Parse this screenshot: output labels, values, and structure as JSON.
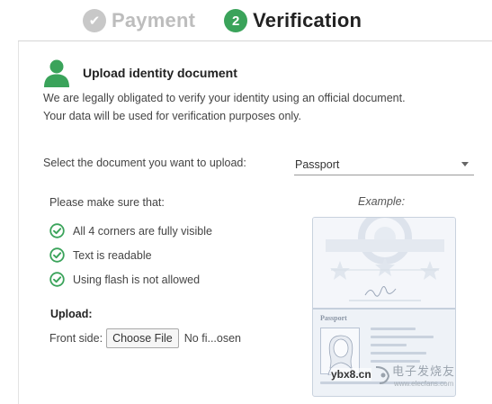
{
  "steps": [
    {
      "label": "Payment",
      "marker": "✔",
      "state": "done"
    },
    {
      "label": "Verification",
      "marker": "2",
      "state": "active"
    }
  ],
  "section": {
    "title": "Upload identity document",
    "intro_line1": "We are legally obligated to verify your identity using an official document.",
    "intro_line2": "Your data will be used for verification purposes only."
  },
  "document_select": {
    "label": "Select the document you want to upload:",
    "value": "Passport"
  },
  "checklist": {
    "heading": "Please make sure that:",
    "items": [
      "All 4 corners are fully visible",
      "Text is readable",
      "Using flash is not allowed"
    ]
  },
  "upload": {
    "heading": "Upload:",
    "front_label": "Front side:",
    "choose_button": "Choose File",
    "file_status": "No fi...osen"
  },
  "example": {
    "label": "Example:",
    "passport_title": "Passport"
  },
  "watermark": {
    "left_text": "ybx8.cn",
    "brand": "电子发烧友",
    "url": "www.elecfans.com"
  },
  "colors": {
    "accent_green": "#3aa35a",
    "done_gray": "#c8c8c8"
  }
}
